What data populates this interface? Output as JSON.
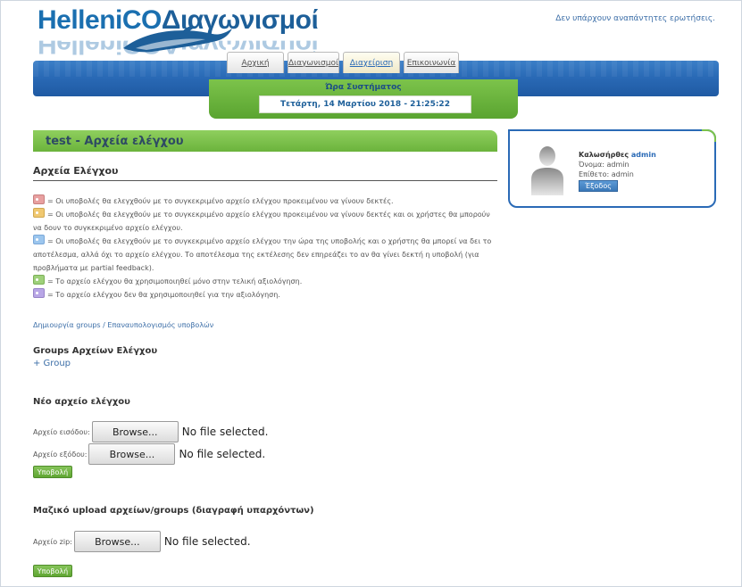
{
  "logo": {
    "text_latin": "HelleniCO",
    "text_greek": "Διαγωνισμοί"
  },
  "header": {
    "unanswered": "Δεν υπάρχουν αναπάντητες ερωτήσεις."
  },
  "nav": {
    "tabs": [
      {
        "label": "Αρχική"
      },
      {
        "label": "Διαγωνισμοί"
      },
      {
        "label": "Διαχείριση"
      },
      {
        "label": "Επικοινωνία"
      }
    ]
  },
  "system_time": {
    "title": "Ώρα Συστήματος",
    "value": "Τετάρτη, 14 Μαρτίου 2018 - 21:25:22"
  },
  "section": {
    "title": "test - Αρχεία ελέγχου"
  },
  "files": {
    "heading": "Αρχεία Ελέγχου",
    "legend": [
      {
        "icon": "red-tag-icon",
        "color": "#e8a0a0",
        "text": "= Οι υποβολές θα ελεγχθούν με το συγκεκριμένο αρχείο ελέγχου προκειμένου να γίνουν δεκτές."
      },
      {
        "icon": "orange-tag-icon",
        "color": "#f0c870",
        "text": "= Οι υποβολές θα ελεγχθούν με το συγκεκριμένο αρχείο ελέγχου προκειμένου να γίνουν δεκτές και οι χρήστες θα μπορούν να δουν το συγκεκριμένο αρχείο ελέγχου."
      },
      {
        "icon": "blue-tag-icon",
        "color": "#9cc6ee",
        "text": "= Οι υποβολές θα ελεγχθούν με το συγκεκριμένο αρχείο ελέγχου την ώρα της υποβολής και ο χρήστης θα μπορεί να δει το αποτέλεσμα, αλλά όχι το αρχείο ελέγχου. Το αποτέλεσμα της εκτέλεσης δεν επηρεάζει το αν θα γίνει δεκτή η υποβολή (για προβλήματα με partial feedback)."
      },
      {
        "icon": "green-tag-icon",
        "color": "#9ed07a",
        "text": "= Το αρχείο ελέγχου θα χρησιμοποιηθεί μόνο στην τελική αξιολόγηση."
      },
      {
        "icon": "purple-tag-icon",
        "color": "#b8a6e6",
        "text": "= Το αρχείο ελέγχου δεν θα χρησιμοποιηθεί για την αξιολόγηση."
      }
    ],
    "groups_link": "Δημιουργία groups / Επαναυπολογισμός υποβολών"
  },
  "groups": {
    "heading": "Groups Αρχείων Ελέγχου",
    "add_label": "+ Group"
  },
  "new_file": {
    "heading": "Νέο αρχείο ελέγχου",
    "input_label": "Αρχείο εισόδου:",
    "output_label": "Αρχείο εξόδου:",
    "browse_label": "Browse...",
    "no_file": "No file selected.",
    "submit_label": "Υποβολή"
  },
  "bulk": {
    "heading": "Μαζικό upload αρχείων/groups (διαγραφή υπαρχόντων)",
    "zip_label": "Αρχείο zip:",
    "browse_label": "Browse...",
    "no_file": "No file selected.",
    "submit_label": "Υποβολή"
  },
  "user": {
    "welcome": "Καλωσήρθες",
    "username": "admin",
    "name_line": "Όνομα: admin",
    "surname_line": "Επίθετο: admin",
    "logout_label": "Έξοδος"
  },
  "colors": {
    "brand_blue": "#2a6ab6",
    "accent_green": "#6bb33c"
  }
}
